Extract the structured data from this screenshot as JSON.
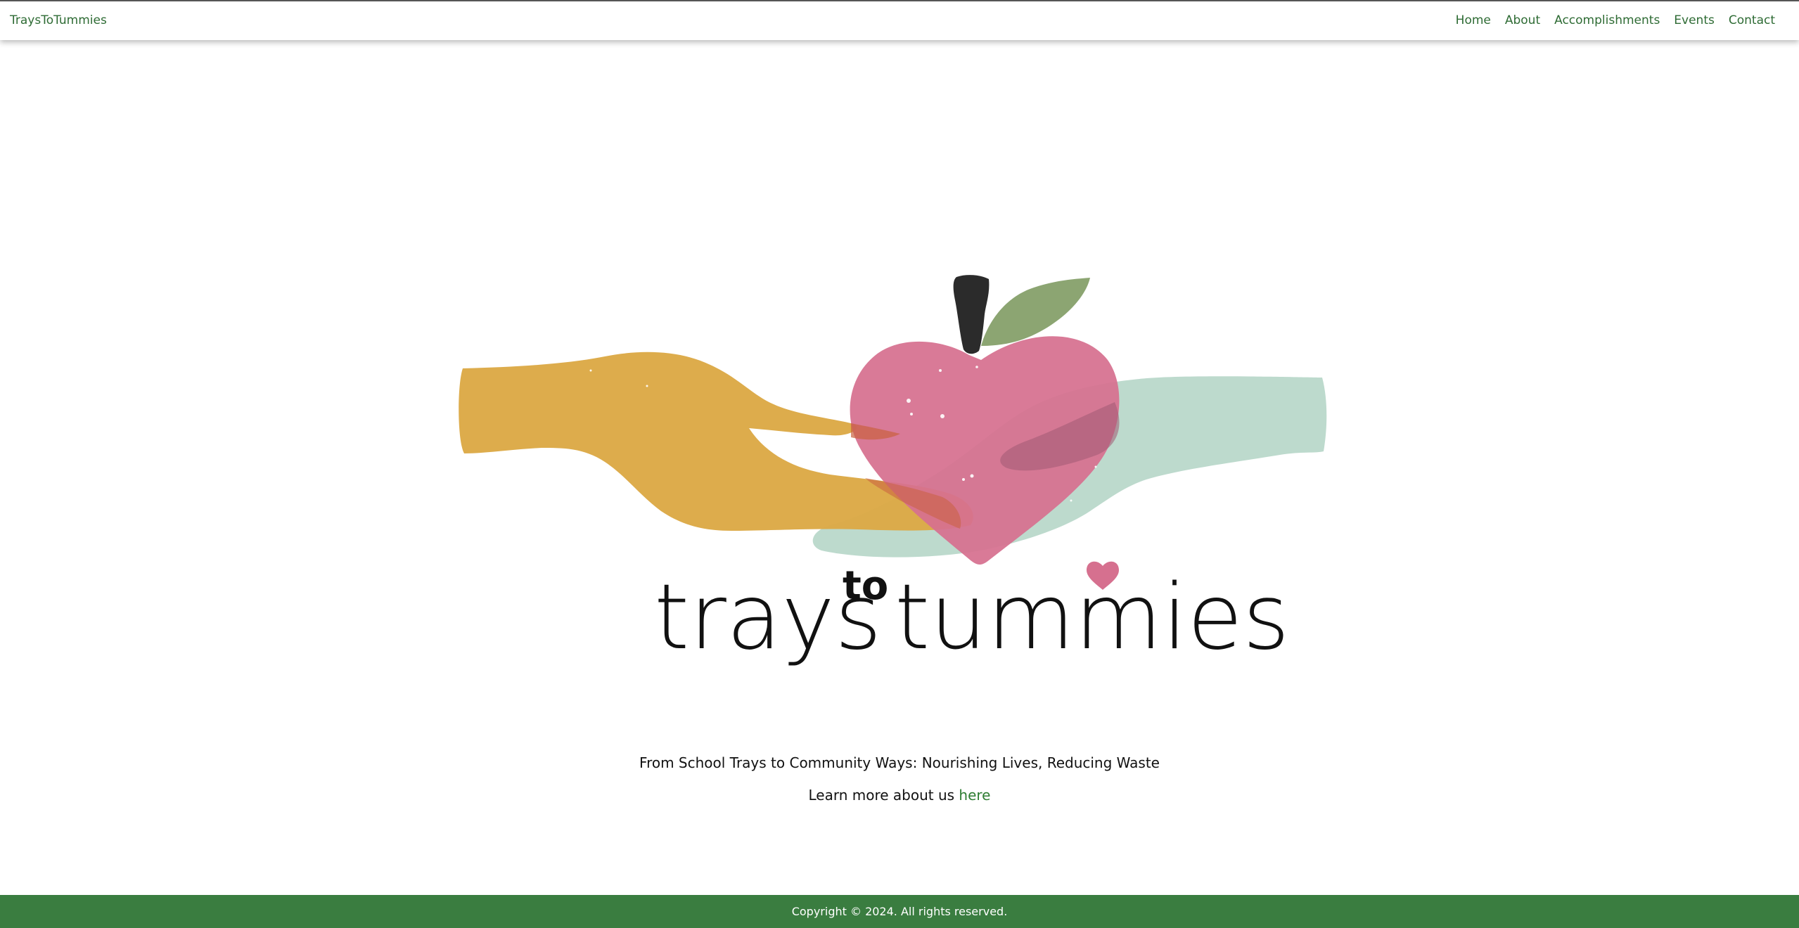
{
  "nav": {
    "brand": "TraysToTummies",
    "links": [
      "Home",
      "About",
      "Accomplishments",
      "Events",
      "Contact"
    ]
  },
  "hero": {
    "logo_text": "trays to tummies",
    "logo_word_1": "trays",
    "logo_word_2": "to",
    "logo_word_3": "tummies",
    "tagline": "From School Trays to Community Ways: Nourishing Lives, Reducing Waste",
    "learn_more_prefix": "Learn more about us ",
    "learn_more_link": "here"
  },
  "footer": {
    "copyright": "Copyright © 2024. All rights reserved."
  },
  "colors": {
    "brand_green": "#2e6b34",
    "footer_green": "#3a7d40",
    "hand_left": "#dca946",
    "hand_right": "#b9d8ca",
    "heart": "#d6708f",
    "leaf": "#6f8f4f",
    "stem": "#2b2b2b"
  },
  "icons": [
    "hand-left-icon",
    "hand-right-icon",
    "heart-apple-icon",
    "leaf-icon",
    "stem-icon",
    "small-heart-icon"
  ]
}
